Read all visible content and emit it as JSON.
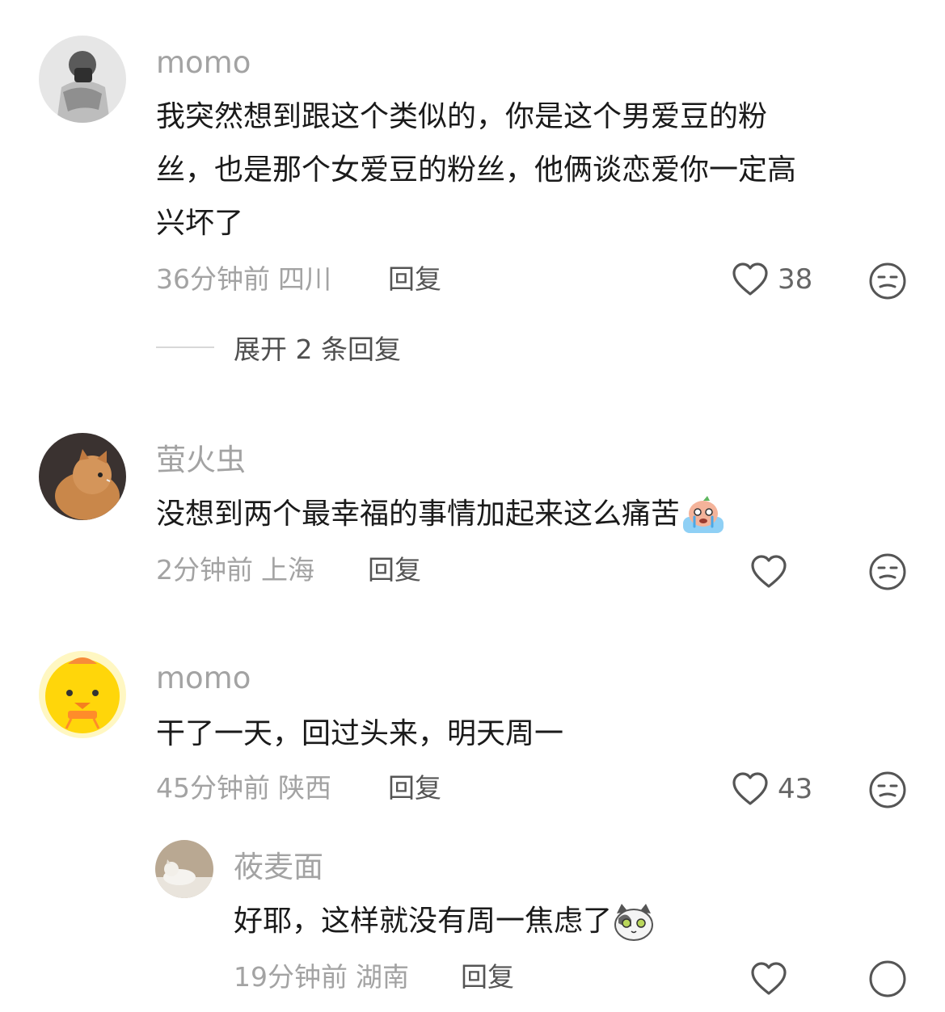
{
  "comments": [
    {
      "username": "momo",
      "text": [
        "我突然想到跟这个类似的，你是这个男爱豆的粉",
        "丝，也是那个女爱豆的粉丝，他俩谈恋爱你一定高",
        "兴坏了"
      ],
      "time": "36分钟前",
      "location": "四川",
      "reply_label": "回复",
      "likes": "38",
      "expand_label": "展开 2 条回复"
    },
    {
      "username": "萤火虫",
      "text": "没想到两个最幸福的事情加起来这么痛苦",
      "emoji": "crying-emoji",
      "time": "2分钟前",
      "location": "上海",
      "reply_label": "回复"
    },
    {
      "username": "momo",
      "text": "干了一天，回过头来，明天周一",
      "time": "45分钟前",
      "location": "陕西",
      "reply_label": "回复",
      "likes": "43",
      "reply": {
        "username": "莜麦面",
        "text": "好耶，这样就没有周一焦虑了",
        "emoji": "cat-emoji",
        "time": "19分钟前",
        "location": "湖南",
        "reply_label": "回复"
      }
    }
  ],
  "watermark": "",
  "colors": {
    "username": "#a3a3a3",
    "text": "#1a1a1a",
    "meta": "#a3a3a3",
    "icon": "#555555"
  }
}
